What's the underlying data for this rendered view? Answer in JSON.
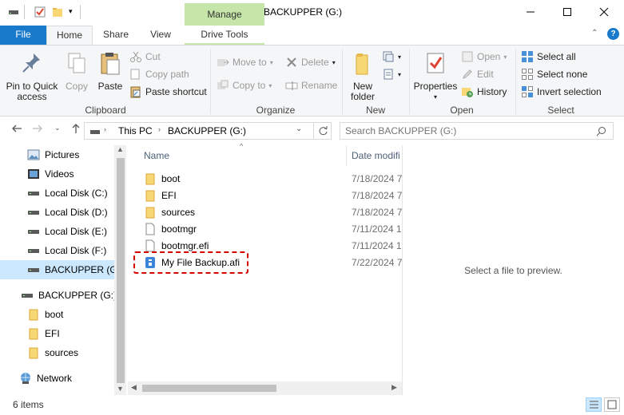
{
  "window": {
    "title": "BACKUPPER (G:)",
    "context_tab": "Manage",
    "controls": [
      "minimize",
      "maximize",
      "close"
    ]
  },
  "ribbon_tabs": [
    "File",
    "Home",
    "Share",
    "View",
    "Drive Tools"
  ],
  "ribbon": {
    "clipboard": {
      "label": "Clipboard",
      "pin_line1": "Pin to Quick",
      "pin_line2": "access",
      "copy": "Copy",
      "paste": "Paste",
      "cut": "Cut",
      "copy_path": "Copy path",
      "paste_shortcut": "Paste shortcut"
    },
    "organize": {
      "label": "Organize",
      "move_to": "Move to",
      "copy_to": "Copy to",
      "delete": "Delete",
      "rename": "Rename"
    },
    "new": {
      "label": "New",
      "new_line1": "New",
      "new_line2": "folder"
    },
    "open": {
      "label": "Open",
      "properties": "Properties",
      "open": "Open",
      "edit": "Edit",
      "history": "History"
    },
    "select": {
      "label": "Select",
      "select_all": "Select all",
      "select_none": "Select none",
      "invert": "Invert selection"
    }
  },
  "address": {
    "crumbs": [
      "This PC",
      "BACKUPPER (G:)"
    ],
    "search_placeholder": "Search BACKUPPER (G:)"
  },
  "nav": {
    "items": [
      {
        "label": "Pictures",
        "icon": "pictures-icon"
      },
      {
        "label": "Videos",
        "icon": "videos-icon"
      },
      {
        "label": "Local Disk (C:)",
        "icon": "drive-icon"
      },
      {
        "label": "Local Disk (D:)",
        "icon": "drive-icon"
      },
      {
        "label": "Local Disk (E:)",
        "icon": "drive-icon"
      },
      {
        "label": "Local Disk (F:)",
        "icon": "drive-icon"
      },
      {
        "label": "BACKUPPER (G:)",
        "icon": "drive-icon",
        "selected": true
      },
      {
        "label": "BACKUPPER (G:)",
        "icon": "drive-icon"
      },
      {
        "label": "boot",
        "icon": "folder-icon"
      },
      {
        "label": "EFI",
        "icon": "folder-icon"
      },
      {
        "label": "sources",
        "icon": "folder-icon"
      },
      {
        "label": "Network",
        "icon": "network-icon"
      }
    ]
  },
  "files": {
    "columns": [
      "Name",
      "Date modifi"
    ],
    "rows": [
      {
        "name": "boot",
        "date": "7/18/2024 7:",
        "icon": "folder-icon"
      },
      {
        "name": "EFI",
        "date": "7/18/2024 7:",
        "icon": "folder-icon"
      },
      {
        "name": "sources",
        "date": "7/18/2024 7:",
        "icon": "folder-icon"
      },
      {
        "name": "bootmgr",
        "date": "7/11/2024 1:",
        "icon": "file-icon"
      },
      {
        "name": "bootmgr.efi",
        "date": "7/11/2024 1:",
        "icon": "file-icon"
      },
      {
        "name": "My File Backup.afi",
        "date": "7/22/2024 7:",
        "icon": "backup-file-icon"
      }
    ]
  },
  "preview": {
    "message": "Select a file to preview."
  },
  "status": {
    "items_count": "6 items"
  },
  "colors": {
    "file_tab": "#1979ca",
    "manage_tab": "#c5e6a8",
    "selection": "#cce8ff",
    "highlight": "#d40000",
    "folder": "#f8d775"
  }
}
